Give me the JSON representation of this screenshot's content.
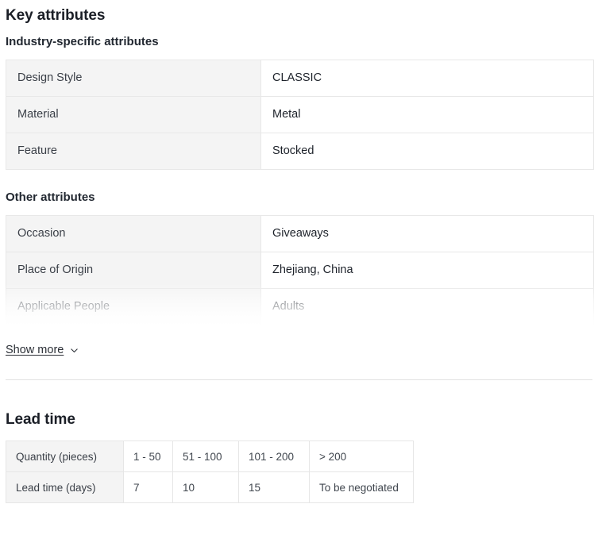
{
  "key_attributes": {
    "title": "Key attributes",
    "industry_section": {
      "title": "Industry-specific attributes",
      "rows": [
        {
          "key": "Design Style",
          "value": "CLASSIC"
        },
        {
          "key": "Material",
          "value": "Metal"
        },
        {
          "key": "Feature",
          "value": "Stocked"
        }
      ]
    },
    "other_section": {
      "title": "Other attributes",
      "rows": [
        {
          "key": "Occasion",
          "value": "Giveaways"
        },
        {
          "key": "Place of Origin",
          "value": "Zhejiang, China"
        },
        {
          "key": "Applicable People",
          "value": "Adults"
        }
      ]
    },
    "show_more": {
      "label": "Show more",
      "icon": "chevron-down-icon"
    }
  },
  "lead_time": {
    "title": "Lead time",
    "rows": [
      {
        "header": "Quantity (pieces)",
        "cells": [
          "1 - 50",
          "51 - 100",
          "101 - 200",
          "> 200"
        ]
      },
      {
        "header": "Lead time (days)",
        "cells": [
          "7",
          "10",
          "15",
          "To be negotiated"
        ]
      }
    ]
  },
  "colors": {
    "heading": "#1b1f27",
    "key_cell_bg": "#f4f4f4",
    "border": "#e8e8e8",
    "value_text": "#1d222a",
    "divider": "#e2e2e2"
  }
}
